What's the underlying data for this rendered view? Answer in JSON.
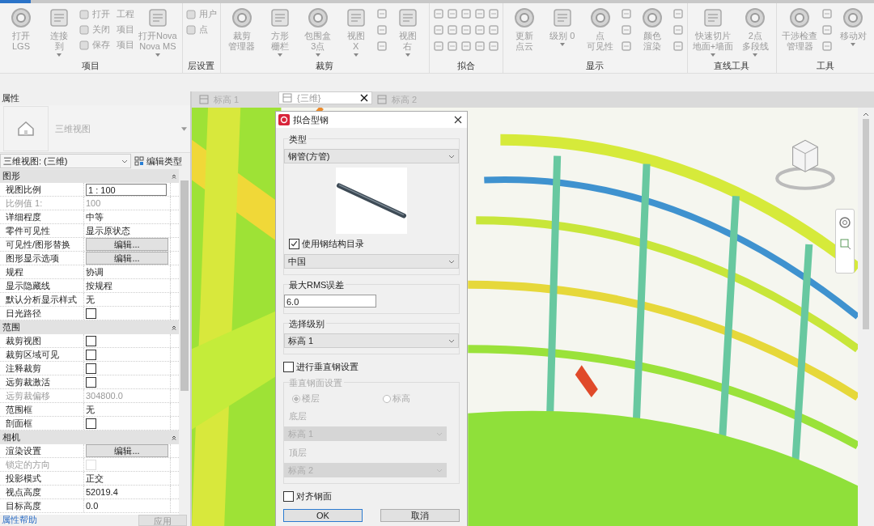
{
  "ribbon": {
    "groups": [
      {
        "label": "项目",
        "columns": [
          {
            "kind": "large",
            "lines": [
              "打开",
              "LGS"
            ],
            "dropdown": false
          },
          {
            "kind": "large",
            "lines": [
              "连接",
              "到"
            ],
            "dropdown": true
          },
          {
            "kind": "stack",
            "items": [
              "打开 工程",
              "关闭 项目",
              "保存 项目"
            ]
          },
          {
            "kind": "large",
            "lines": [
              "打开Nova",
              "Nova MS"
            ],
            "dropdown": true
          }
        ]
      },
      {
        "label": "层设置",
        "columns": [
          {
            "kind": "stack",
            "items": [
              "用户",
              "点"
            ]
          }
        ]
      },
      {
        "label": "裁剪",
        "columns": [
          {
            "kind": "large",
            "lines": [
              "裁剪",
              "管理器"
            ],
            "dropdown": false
          },
          {
            "kind": "large",
            "lines": [
              "方形",
              "栅栏"
            ],
            "dropdown": true
          },
          {
            "kind": "large",
            "lines": [
              "包围盒",
              "3点"
            ],
            "dropdown": true
          },
          {
            "kind": "large",
            "lines": [
              "视图",
              "X"
            ],
            "dropdown": true
          },
          {
            "kind": "icons"
          },
          {
            "kind": "large",
            "lines": [
              "视图",
              "右"
            ],
            "dropdown": true
          }
        ]
      },
      {
        "label": "拟合",
        "columns": [
          {
            "kind": "icons"
          },
          {
            "kind": "icons"
          },
          {
            "kind": "icons"
          },
          {
            "kind": "icons"
          },
          {
            "kind": "icons"
          }
        ]
      },
      {
        "label": "显示",
        "columns": [
          {
            "kind": "large",
            "lines": [
              "更新",
              "点云"
            ],
            "dropdown": false
          },
          {
            "kind": "large",
            "lines": [
              "级别 0"
            ],
            "dropdown": true
          },
          {
            "kind": "large",
            "lines": [
              "点",
              "可见性"
            ],
            "dropdown": false
          },
          {
            "kind": "icons"
          },
          {
            "kind": "large",
            "lines": [
              "颜色",
              "渲染"
            ],
            "dropdown": false
          },
          {
            "kind": "icons"
          }
        ]
      },
      {
        "label": "直线工具",
        "columns": [
          {
            "kind": "large",
            "lines": [
              "快速切片",
              "地面+墙面"
            ],
            "dropdown": true
          },
          {
            "kind": "large",
            "lines": [
              "2点",
              "多段线"
            ],
            "dropdown": true
          }
        ]
      },
      {
        "label": "工具",
        "columns": [
          {
            "kind": "large",
            "lines": [
              "干涉检查",
              "管理器"
            ],
            "dropdown": false
          },
          {
            "kind": "icons"
          },
          {
            "kind": "large",
            "lines": [
              "移动对"
            ],
            "dropdown": true
          }
        ]
      }
    ]
  },
  "properties": {
    "title": "属性",
    "type_name": "三维视图",
    "instance": "三维视图: (三维)",
    "edit_type": "编辑类型",
    "sections": [
      {
        "title": "图形",
        "rows": [
          {
            "label": "视图比例",
            "kind": "input",
            "value": "1 : 100",
            "disabled": false
          },
          {
            "label": "比例值 1:",
            "kind": "text",
            "value": "100",
            "disabled": true
          },
          {
            "label": "详细程度",
            "kind": "text",
            "value": "中等",
            "disabled": false
          },
          {
            "label": "零件可见性",
            "kind": "text",
            "value": "显示原状态",
            "disabled": false
          },
          {
            "label": "可见性/图形替换",
            "kind": "button",
            "value": "编辑...",
            "disabled": false
          },
          {
            "label": "图形显示选项",
            "kind": "button",
            "value": "编辑...",
            "disabled": false
          },
          {
            "label": "规程",
            "kind": "text",
            "value": "协调",
            "disabled": false
          },
          {
            "label": "显示隐藏线",
            "kind": "text",
            "value": "按规程",
            "disabled": false
          },
          {
            "label": "默认分析显示样式",
            "kind": "text",
            "value": "无",
            "disabled": false
          },
          {
            "label": "日光路径",
            "kind": "checkbox",
            "checked": false,
            "disabled": false
          }
        ]
      },
      {
        "title": "范围",
        "rows": [
          {
            "label": "裁剪视图",
            "kind": "checkbox",
            "checked": false,
            "disabled": false
          },
          {
            "label": "裁剪区域可见",
            "kind": "checkbox",
            "checked": false,
            "disabled": false
          },
          {
            "label": "注释裁剪",
            "kind": "checkbox",
            "checked": false,
            "disabled": false
          },
          {
            "label": "远剪裁激活",
            "kind": "checkbox",
            "checked": false,
            "disabled": false
          },
          {
            "label": "远剪裁偏移",
            "kind": "text",
            "value": "304800.0",
            "disabled": true
          },
          {
            "label": "范围框",
            "kind": "text",
            "value": "无",
            "disabled": false
          },
          {
            "label": "剖面框",
            "kind": "checkbox",
            "checked": false,
            "disabled": false
          }
        ]
      },
      {
        "title": "相机",
        "rows": [
          {
            "label": "渲染设置",
            "kind": "button",
            "value": "编辑...",
            "disabled": false
          },
          {
            "label": "锁定的方向",
            "kind": "checkbox",
            "checked": false,
            "disabled": true
          },
          {
            "label": "投影模式",
            "kind": "text",
            "value": "正交",
            "disabled": false
          },
          {
            "label": "视点高度",
            "kind": "text",
            "value": "52019.4",
            "disabled": false
          },
          {
            "label": "目标高度",
            "kind": "text",
            "value": "0.0",
            "disabled": false
          }
        ]
      }
    ],
    "help": "属性帮助",
    "apply": "应用"
  },
  "tabs": [
    {
      "label": "标高 1",
      "selected": false,
      "closable": false
    },
    {
      "label": "{三维}",
      "selected": true,
      "closable": true
    },
    {
      "label": "标高 2",
      "selected": false,
      "closable": false
    }
  ],
  "dialog": {
    "title": "拟合型钢",
    "type_group": "类型",
    "type_value": "钢管(方管)",
    "use_catalog": {
      "label": "使用钢结构目录",
      "checked": true
    },
    "catalog_value": "中国",
    "rms_group": "最大RMS误差",
    "rms_value": "6.0",
    "level_group": "选择级别",
    "level_value": "标高 1",
    "vertical": {
      "label": "进行垂直钢设置",
      "checked": false
    },
    "vertical_group": {
      "title": "垂直钢面设置",
      "disabled": true,
      "radios": [
        {
          "label": "楼层",
          "selected": true
        },
        {
          "label": "标高",
          "selected": false
        }
      ],
      "bottom_label": "底层",
      "bottom_value": "标高 1",
      "top_label": "顶层",
      "top_value": "标高 2"
    },
    "align": {
      "label": "对齐钢面",
      "checked": false
    },
    "ok": "OK",
    "cancel": "取消"
  }
}
